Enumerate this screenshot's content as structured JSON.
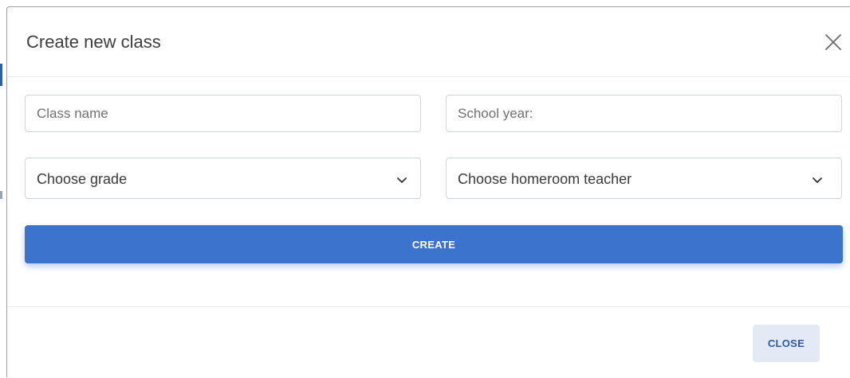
{
  "dialog": {
    "title": "Create new class",
    "close_icon": "close-x-icon"
  },
  "form": {
    "class_name": {
      "placeholder": "Class name",
      "value": ""
    },
    "school_year": {
      "placeholder": "School year:",
      "value": ""
    },
    "grade_select": {
      "selected": "Choose grade",
      "icon": "chevron-down-icon"
    },
    "teacher_select": {
      "selected": "Choose homeroom teacher",
      "icon": "chevron-down-icon"
    },
    "create_label": "CREATE"
  },
  "footer": {
    "close_label": "CLOSE"
  },
  "colors": {
    "primary": "#3c73cd",
    "secondary_bg": "#e3eaf5",
    "secondary_text": "#2f5a9e",
    "title": "#3d3d3d",
    "border": "#cfd4da"
  }
}
